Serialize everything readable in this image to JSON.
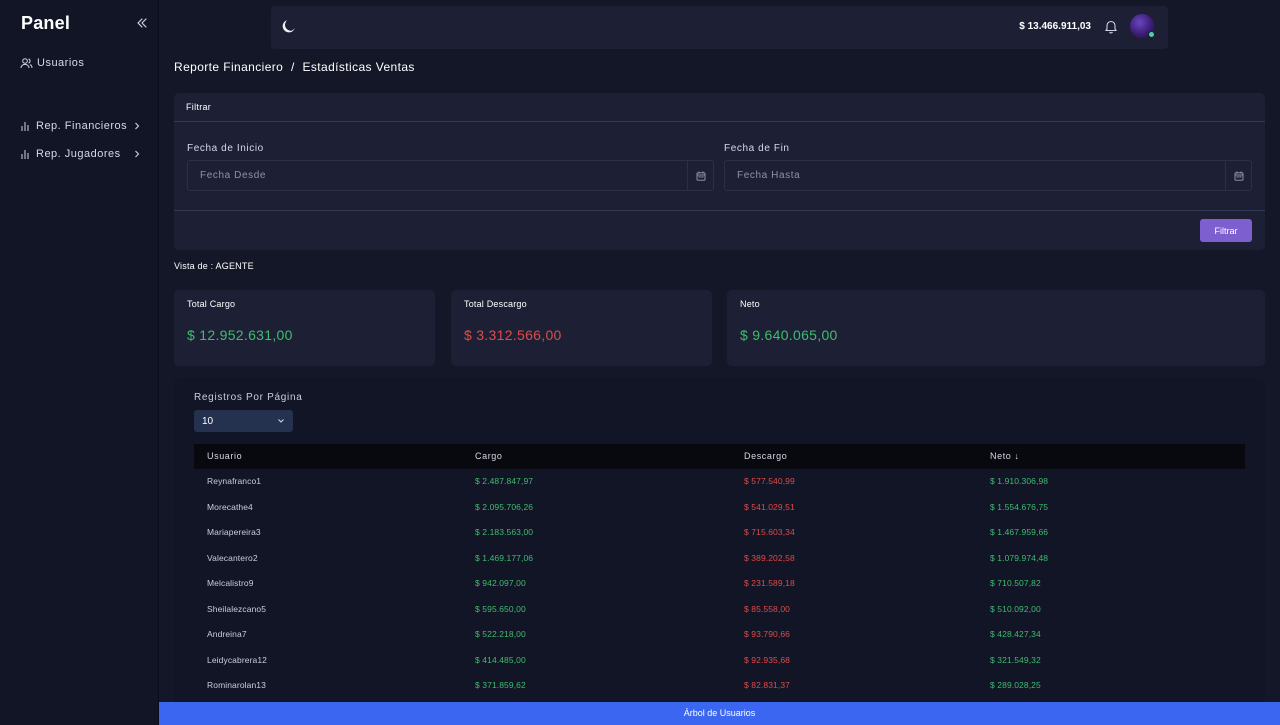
{
  "sidebar": {
    "brand": "Panel",
    "items": [
      {
        "label": "Usuarios"
      },
      {
        "label": "Rep. Financieros"
      },
      {
        "label": "Rep. Jugadores"
      }
    ]
  },
  "topbar": {
    "balance": "$ 13.466.911,03"
  },
  "breadcrumb": {
    "parent": "Reporte Financiero",
    "separator": "/",
    "current": "Estadísticas Ventas"
  },
  "filter": {
    "title": "Filtrar",
    "start_label": "Fecha de Inicio",
    "start_placeholder": "Fecha Desde",
    "end_label": "Fecha de Fin",
    "end_placeholder": "Fecha Hasta",
    "button": "Filtrar"
  },
  "vista": "Vista de : AGENTE",
  "stats": {
    "cargo": {
      "title": "Total Cargo",
      "value": "$ 12.952.631,00",
      "color": "#3fbd6c"
    },
    "descargo": {
      "title": "Total Descargo",
      "value": "$ 3.312.566,00",
      "color": "#e04a4a"
    },
    "neto": {
      "title": "Neto",
      "value": "$ 9.640.065,00",
      "color": "#3fbd6c"
    }
  },
  "table": {
    "rpp_label": "Registros Por Página",
    "rpp_value": "10",
    "headers": [
      "Usuario",
      "Cargo",
      "Descargo",
      "Neto ↓"
    ],
    "rows": [
      [
        "Reynafranco1",
        "$ 2.487.847,97",
        "$ 577.540,99",
        "$ 1.910.306,98"
      ],
      [
        "Morecathe4",
        "$ 2.095.706,26",
        "$ 541.029,51",
        "$ 1.554.676,75"
      ],
      [
        "Mariapereira3",
        "$ 2.183.563,00",
        "$ 715.603,34",
        "$ 1.467.959,66"
      ],
      [
        "Valecantero2",
        "$ 1.469.177,06",
        "$ 389.202,58",
        "$ 1.079.974,48"
      ],
      [
        "Melcalistro9",
        "$ 942.097,00",
        "$ 231.589,18",
        "$ 710.507,82"
      ],
      [
        "Sheilalezcano5",
        "$ 595.650,00",
        "$ 85.558,00",
        "$ 510.092,00"
      ],
      [
        "Andreina7",
        "$ 522.218,00",
        "$ 93.790,66",
        "$ 428.427,34"
      ],
      [
        "Leidycabrera12",
        "$ 414.485,00",
        "$ 92.935,68",
        "$ 321.549,32"
      ],
      [
        "Rominarolan13",
        "$ 371.859,62",
        "$ 82.831,37",
        "$ 289.028,25"
      ]
    ]
  },
  "bottom_bar": "Árbol de Usuarios",
  "colors": {
    "accent": "#7d5fd0",
    "positive": "#3fbd6c",
    "negative": "#e04a4a",
    "bottom_bar": "#3a66f2"
  }
}
